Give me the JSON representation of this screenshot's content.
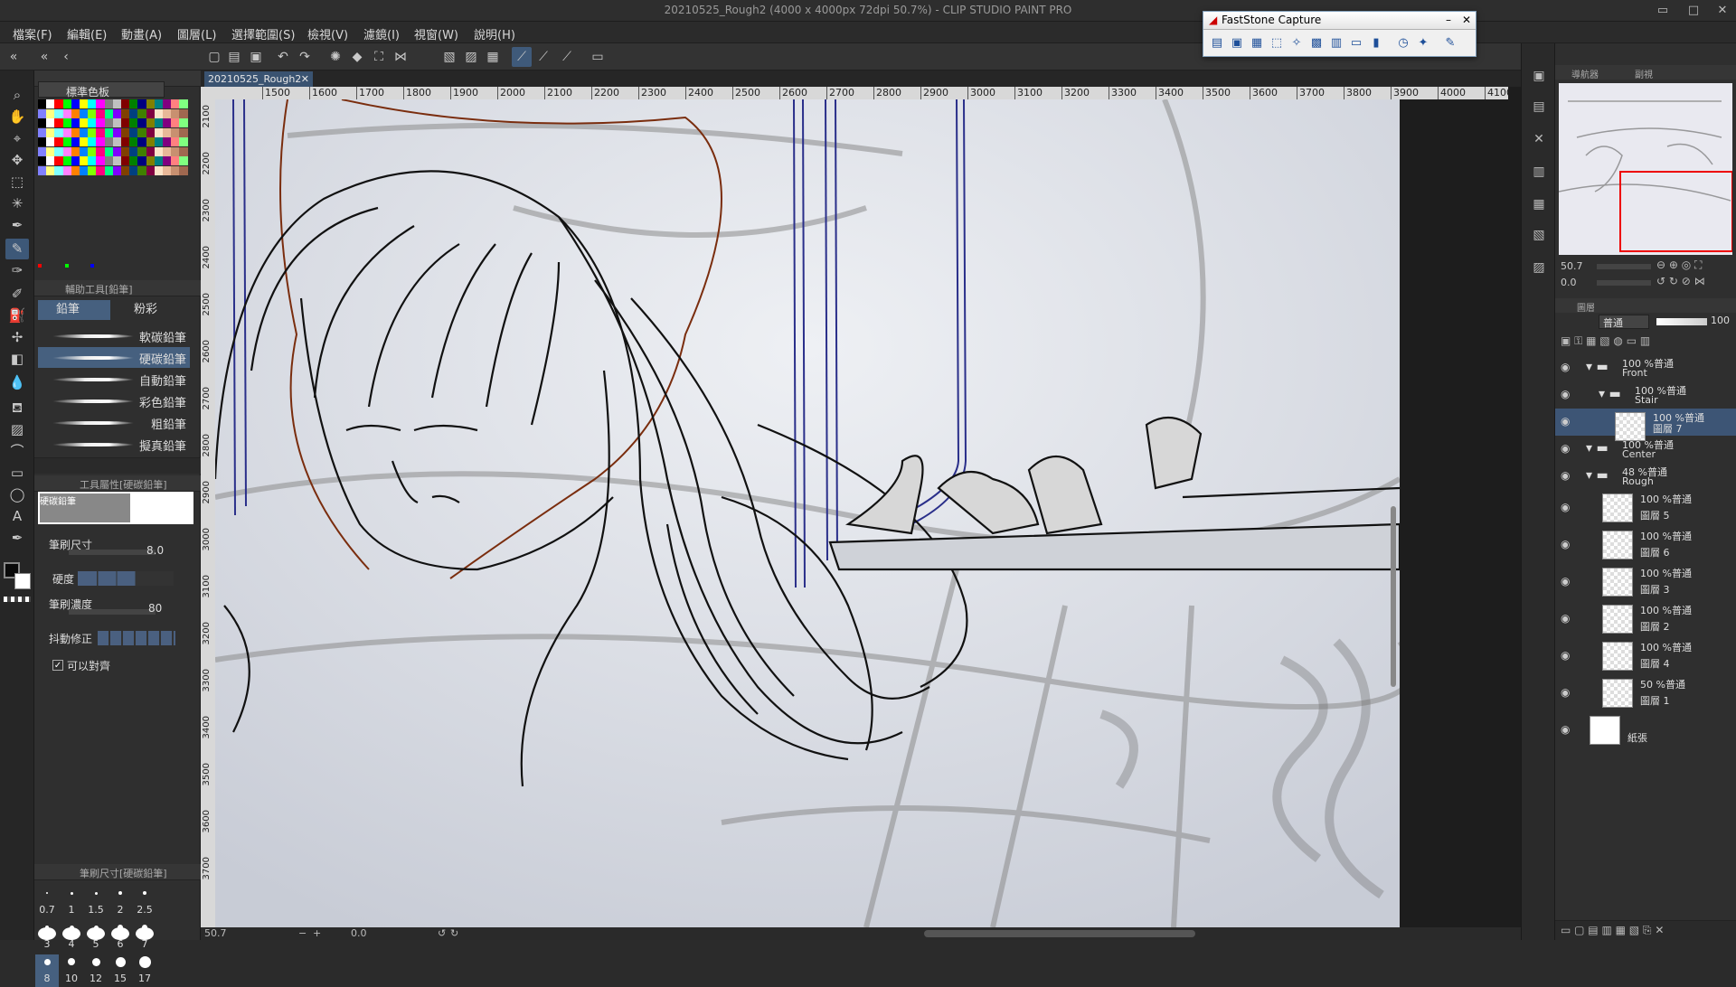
{
  "window": {
    "title": "20210525_Rough2 (4000 x 4000px 72dpi 50.7%) - CLIP STUDIO PAINT PRO",
    "min": "▭",
    "max": "□",
    "close": "✕"
  },
  "menu": [
    "檔案(F)",
    "編輯(E)",
    "動畫(A)",
    "圖層(L)",
    "選擇範圍(S)",
    "檢視(V)",
    "濾鏡(I)",
    "視窗(W)",
    "說明(H)"
  ],
  "doc_tab": "20210525_Rough2",
  "color_panel": {
    "title": "標準色板",
    "colors": [
      "#000000",
      "#ffffff",
      "#ff0000",
      "#00ff00",
      "#0000ff",
      "#ffff00",
      "#00ffff",
      "#ff00ff",
      "#808080",
      "#c0c0c0",
      "#800000",
      "#008000",
      "#000080",
      "#808000",
      "#008080",
      "#800080",
      "#ff8080",
      "#80ff80",
      "#8080ff",
      "#ffff80",
      "#80ffff",
      "#ff80ff",
      "#ff8000",
      "#0080ff",
      "#80ff00",
      "#ff0080",
      "#00ff80",
      "#8000ff",
      "#804000",
      "#004080",
      "#408000",
      "#800040",
      "#fce4c8",
      "#e8b898",
      "#c89070",
      "#a06850"
    ]
  },
  "subtool": {
    "header": "輔助工具[鉛筆]",
    "tabs": [
      "鉛筆",
      "粉彩"
    ],
    "brushes": [
      "軟碳鉛筆",
      "硬碳鉛筆",
      "自動鉛筆",
      "彩色鉛筆",
      "粗鉛筆",
      "擬真鉛筆"
    ]
  },
  "tool_props": {
    "header": "工具屬性[硬碳鉛筆]",
    "preview_label": "硬碳鉛筆",
    "brush_size_label": "筆刷尺寸",
    "brush_size": "8.0",
    "hardness_label": "硬度",
    "density_label": "筆刷濃度",
    "density": "80",
    "stabilize_label": "抖動修正",
    "snap_label": "可以對齊"
  },
  "brush_size_panel": {
    "header": "筆刷尺寸[硬碳鉛筆]",
    "sizes": [
      "0.7",
      "1",
      "1.5",
      "2",
      "2.5",
      "3",
      "4",
      "5",
      "6",
      "7",
      "8",
      "10",
      "12",
      "15",
      "17"
    ]
  },
  "ruler": {
    "h_ticks": [
      "1500",
      "1600",
      "1700",
      "1800",
      "1900",
      "2000",
      "2100",
      "2200",
      "2300",
      "2400",
      "2500",
      "2600",
      "2700",
      "2800",
      "2900",
      "3000",
      "3100",
      "3200",
      "3300",
      "3400",
      "3500",
      "3600",
      "3700",
      "3800",
      "3900",
      "4000",
      "4100"
    ],
    "v_ticks": [
      "2100",
      "2200",
      "2300",
      "2400",
      "2500",
      "2600",
      "2700",
      "2800",
      "2900",
      "3000",
      "3100",
      "3200",
      "3300",
      "3400",
      "3500",
      "3600",
      "3700"
    ]
  },
  "status": {
    "zoom": "50.7",
    "rotation": "0.0"
  },
  "faststone": {
    "title": "FastStone Capture"
  },
  "navigator": {
    "tabs": [
      "導航器",
      "副視"
    ],
    "zoom": "50.7",
    "angle": "0.0"
  },
  "layer_panel": {
    "tabs": [
      "圖層"
    ],
    "blend_mode": "普通",
    "opacity": "100",
    "layers": [
      {
        "l1": "100 %普通",
        "l2": "Front",
        "kind": "folder",
        "indent": 0,
        "selected": false
      },
      {
        "l1": "100 %普通",
        "l2": "Stair",
        "kind": "folder",
        "indent": 1,
        "selected": false
      },
      {
        "l1": "100 %普通",
        "l2": "圖層 7",
        "kind": "raster",
        "indent": 2,
        "selected": true
      },
      {
        "l1": "100 %普通",
        "l2": "Center",
        "kind": "folder",
        "indent": 0,
        "selected": false
      },
      {
        "l1": "48 %普通",
        "l2": "Rough",
        "kind": "folder",
        "indent": 0,
        "selected": false
      },
      {
        "l1": "100 %普通",
        "l2": "圖層 5",
        "kind": "raster",
        "indent": 1,
        "selected": false
      },
      {
        "l1": "100 %普通",
        "l2": "圖層 6",
        "kind": "raster",
        "indent": 1,
        "selected": false
      },
      {
        "l1": "100 %普通",
        "l2": "圖層 3",
        "kind": "raster",
        "indent": 1,
        "selected": false
      },
      {
        "l1": "100 %普通",
        "l2": "圖層 2",
        "kind": "raster",
        "indent": 1,
        "selected": false
      },
      {
        "l1": "100 %普通",
        "l2": "圖層 4",
        "kind": "raster",
        "indent": 1,
        "selected": false
      },
      {
        "l1": "50 %普通",
        "l2": "圖層 1",
        "kind": "raster",
        "indent": 1,
        "selected": false
      },
      {
        "l1": "",
        "l2": "紙張",
        "kind": "paper",
        "indent": 0,
        "selected": false
      }
    ]
  }
}
